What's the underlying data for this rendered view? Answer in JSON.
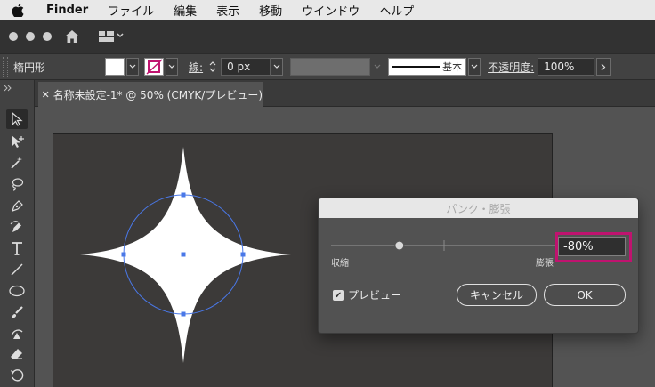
{
  "menubar": {
    "app": "Finder",
    "items": [
      "ファイル",
      "編集",
      "表示",
      "移動",
      "ウインドウ",
      "ヘルプ"
    ]
  },
  "control": {
    "shape_label": "楕円形",
    "stroke_label": "線",
    "stroke_value": "0 px",
    "profile_label": "基本",
    "opacity_label": "不透明度",
    "opacity_value": "100%"
  },
  "document": {
    "tab_title": "名称未設定-1* @ 50% (CMYK/プレビュー)"
  },
  "dialog": {
    "title": "パンク・膨張",
    "left_label": "収縮",
    "right_label": "膨張",
    "slider_value": -80,
    "value_text": "-80%",
    "preview_label": "プレビュー",
    "preview_checked": true,
    "cancel_label": "キャンセル",
    "ok_label": "OK"
  },
  "colors": {
    "accent_highlight": "#c0136f",
    "selection": "#4a78e8",
    "canvas": "#3c3a39"
  }
}
